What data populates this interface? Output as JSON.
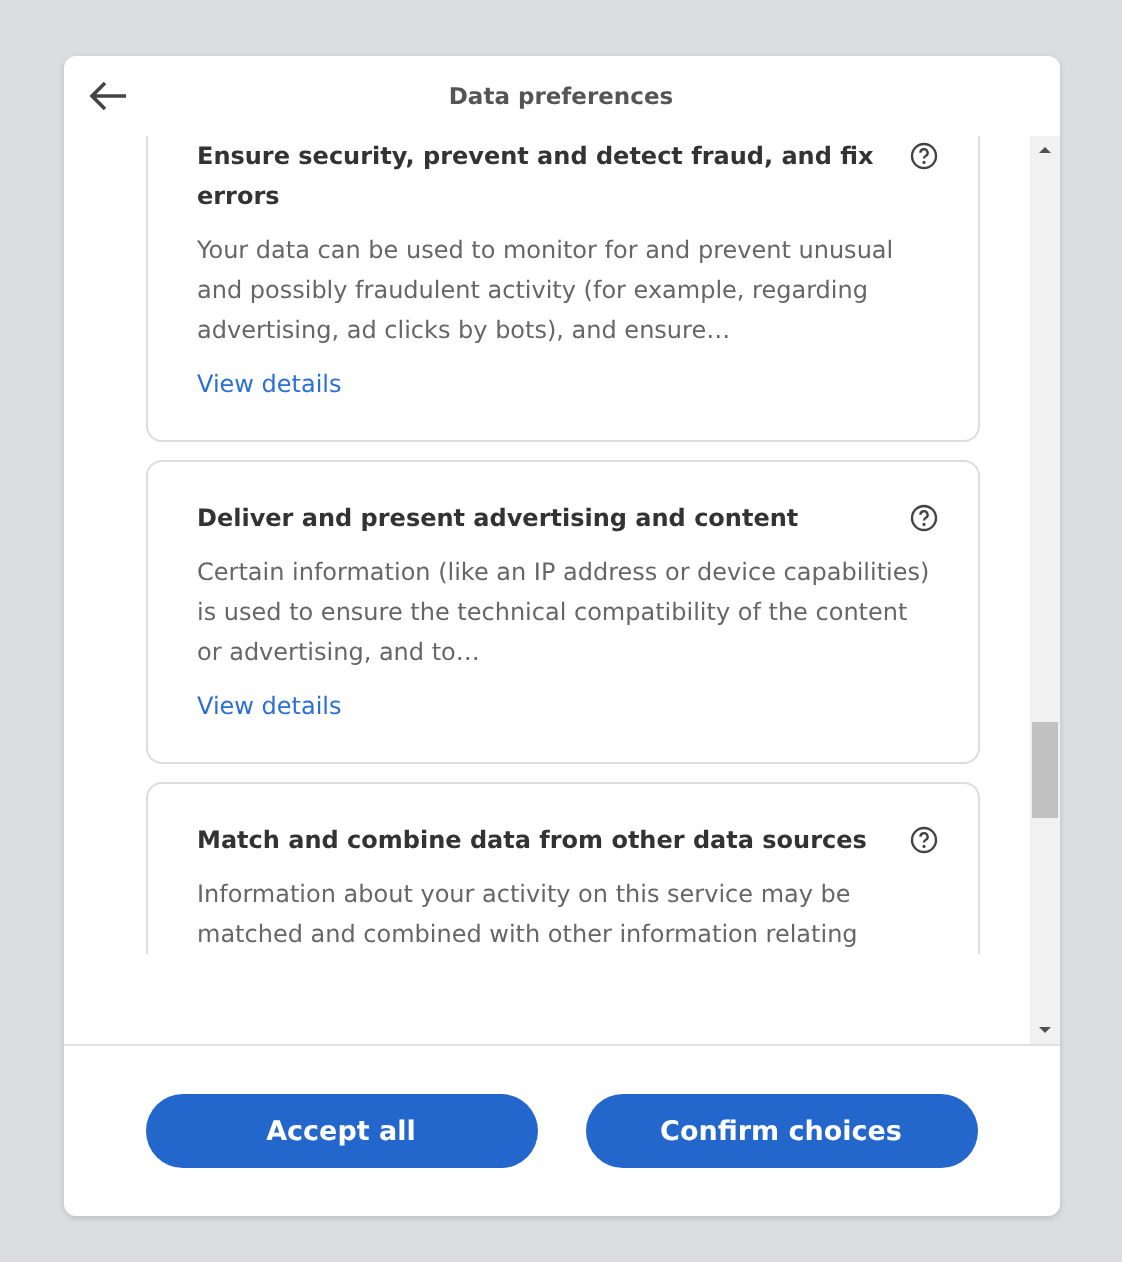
{
  "dialog": {
    "title": "Data preferences"
  },
  "purposes": [
    {
      "title": "Ensure security, prevent and detect fraud, and fix errors",
      "description": "Your data can be used to monitor for and prevent unusual and possibly fraudulent activity (for example, regarding advertising, ad clicks by bots), and ensure…",
      "link": "View details"
    },
    {
      "title": "Deliver and present advertising and content",
      "description": "Certain information (like an IP address or device capabilities) is used to ensure the technical compatibility of the content or advertising, and to…",
      "link": "View details"
    },
    {
      "title": "Match and combine data from other data sources",
      "description": "Information about your activity on this service may be matched and combined with other information relating"
    }
  ],
  "buttons": [
    "Accept all",
    "Confirm choices"
  ]
}
